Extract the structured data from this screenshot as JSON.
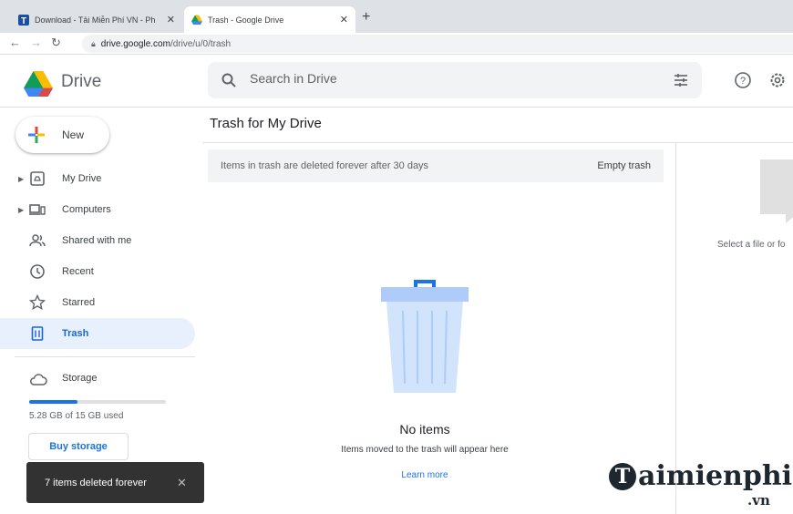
{
  "browser": {
    "tabs": [
      {
        "title": "Download - Tải Miễn Phí VN - Ph",
        "icon": "taimienphi-favicon",
        "active": false,
        "close": "✕"
      },
      {
        "title": "Trash - Google Drive",
        "icon": "google-drive-favicon",
        "active": true,
        "close": "✕"
      }
    ],
    "new_tab": "+",
    "url_host": "drive.google.com",
    "url_path": "/drive/u/0/trash"
  },
  "app": {
    "name": "Drive",
    "search_placeholder": "Search in Drive"
  },
  "sidebar": {
    "new_label": "New",
    "items": [
      {
        "label": "My Drive",
        "icon": "my-drive-icon",
        "expandable": true
      },
      {
        "label": "Computers",
        "icon": "computers-icon",
        "expandable": true
      },
      {
        "label": "Shared with me",
        "icon": "shared-icon",
        "expandable": false
      },
      {
        "label": "Recent",
        "icon": "clock-icon",
        "expandable": false
      },
      {
        "label": "Starred",
        "icon": "star-icon",
        "expandable": false
      },
      {
        "label": "Trash",
        "icon": "trash-icon",
        "expandable": false,
        "active": true
      }
    ],
    "storage_label": "Storage",
    "storage_used_text": "5.28 GB of 15 GB used",
    "storage_fraction": 0.352,
    "buy_storage_label": "Buy storage"
  },
  "main": {
    "title": "Trash for My Drive",
    "banner_text": "Items in trash are deleted forever after 30 days",
    "empty_trash_label": "Empty trash",
    "empty_title": "No items",
    "empty_subtitle": "Items moved to the trash will appear here",
    "learn_more": "Learn more",
    "details_hint": "Select a file or fo"
  },
  "toast": {
    "message": "7 items deleted forever",
    "close": "✕"
  },
  "watermark": {
    "glyph": "T",
    "text": "aimienphi",
    "suffix": ".vn"
  },
  "colors": {
    "accent": "#1a73e8",
    "active_bg": "#e8f0fe",
    "toast_bg": "#323232"
  }
}
